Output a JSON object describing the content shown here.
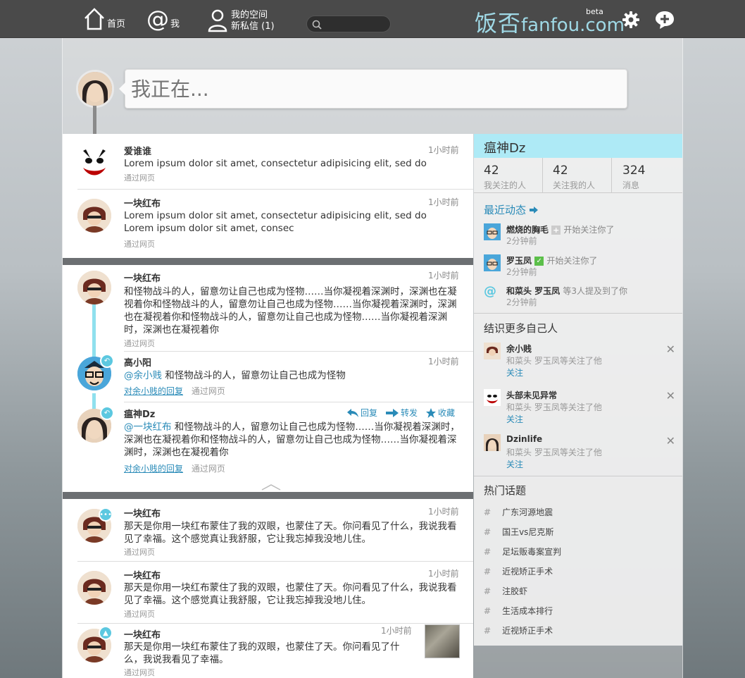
{
  "topbar": {
    "home_label": "首页",
    "me_label": "我",
    "space_label": "我的空间",
    "messages_label": "新私信 (1)",
    "search_placeholder": "",
    "logo_cn": "饭否",
    "logo_en": "fanfou.com",
    "logo_beta": "beta"
  },
  "composer": {
    "placeholder": "我正在..."
  },
  "posts": [
    {
      "name": "爱谁谁",
      "time": "1小时前",
      "text": "Lorem ipsum dolor sit amet, consectetur adipisicing elit, sed do",
      "via": "通过网页"
    },
    {
      "name": "一块红布",
      "time": "1小时前",
      "text": "Lorem ipsum dolor sit amet, consectetur adipisicing elit, sed do Lorem ipsum dolor sit amet, consec",
      "via": "通过网页"
    }
  ],
  "thread": {
    "main": {
      "name": "一块红布",
      "time": "1小时前",
      "text": "和怪物战斗的人，留意勿让自己也成为怪物……当你凝视着深渊时，深渊也在凝视着你和怪物战斗的人，留意勿让自己也成为怪物……当你凝视着深渊时，深渊也在凝视着你和怪物战斗的人，留意勿让自己也成为怪物……当你凝视着深渊时，深渊也在凝视着你",
      "via": "通过网页"
    },
    "reply1": {
      "name": "高小阳",
      "time": "1小时前",
      "mention": "@余小贱",
      "text": " 和怪物战斗的人，留意勿让自己也成为怪物",
      "reply_to": "对余小贱的回复",
      "via": "通过网页"
    },
    "reply2": {
      "name": "瘟神Dz",
      "mention": "@一块红布",
      "text": " 和怪物战斗的人，留意勿让自己也成为怪物……当你凝视着深渊时，深渊也在凝视着你和怪物战斗的人，留意勿让自己也成为怪物……当你凝视着深渊时，深渊也在凝视着你",
      "reply_to": "对余小贱的回复",
      "via": "通过网页",
      "actions": {
        "reply": "回复",
        "repost": "转发",
        "favorite": "收藏"
      }
    }
  },
  "posts2": [
    {
      "name": "一块红布",
      "time": "1小时前",
      "text": "那天是你用一块红布蒙住了我的双眼，也蒙住了天。你问看见了什么，我说我看见了幸福。这个感觉真让我舒服，它让我忘掉我没地儿住。",
      "via": "通过网页"
    },
    {
      "name": "一块红布",
      "time": "1小时前",
      "text": "那天是你用一块红布蒙住了我的双眼，也蒙住了天。你问看见了什么，我说我看见了幸福。这个感觉真让我舒服，它让我忘掉我没地儿住。",
      "via": "通过网页"
    },
    {
      "name": "一块红布",
      "time": "1小时前",
      "text": "那天是你用一块红布蒙住了我的双眼，也蒙住了天。你问看见了什么，我说我看见了幸福。",
      "via": "通过网页"
    }
  ],
  "sidebar": {
    "username": "瘟神Dz",
    "stats": [
      {
        "num": "42",
        "label": "我关注的人"
      },
      {
        "num": "42",
        "label": "关注我的人"
      },
      {
        "num": "324",
        "label": "消息"
      }
    ],
    "recent_title": "最近动态",
    "activities": [
      {
        "name": "燃烧的胸毛",
        "desc": "开始关注你了",
        "time": "2分钟前"
      },
      {
        "name": "罗玉凤",
        "desc": "开始关注你了",
        "time": "2分钟前"
      },
      {
        "name": "和菜头 罗玉凤",
        "desc": "等3人提及到了你",
        "time": "2分钟前"
      }
    ],
    "suggest_title": "结识更多自己人",
    "suggestions": [
      {
        "name": "余小贱",
        "desc": "和菜头 罗玉凤等关注了他",
        "follow": "关注"
      },
      {
        "name": "头部未见异常",
        "desc": "和菜头 罗玉凤等关注了他",
        "follow": "关注"
      },
      {
        "name": "Dzinlife",
        "desc": "和菜头 罗玉凤等关注了他",
        "follow": "关注"
      }
    ],
    "topics_title": "热门话题",
    "topics": [
      "广东河源地震",
      "国王vs尼克斯",
      "足坛贩毒案宣判",
      "近视矫正手术",
      "注胶虾",
      "生活成本排行",
      "近视矫正手术"
    ]
  },
  "colors": {
    "accent": "#2a8bb8",
    "sidebar_head": "#aeeaf6",
    "topbar": "#4a4a4a"
  }
}
